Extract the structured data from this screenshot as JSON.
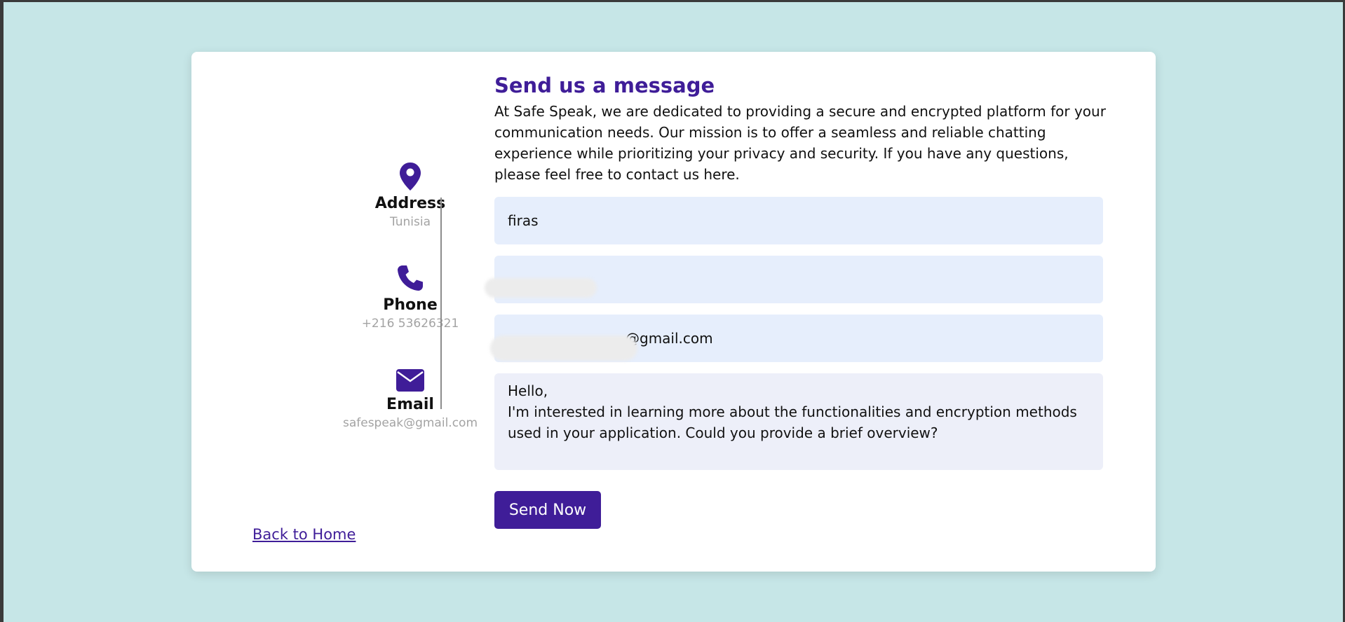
{
  "contact_info": {
    "address": {
      "icon": "map-pin-icon",
      "title": "Address",
      "value": "Tunisia"
    },
    "phone": {
      "icon": "phone-icon",
      "title": "Phone",
      "value": "+216 53626321"
    },
    "email": {
      "icon": "envelope-icon",
      "title": "Email",
      "value": "safespeak@gmail.com"
    }
  },
  "back_link": "Back to Home",
  "form": {
    "title": "Send us a message",
    "description": "At Safe Speak, we are dedicated to providing a secure and encrypted platform for your communication needs. Our mission is to offer a seamless and reliable chatting experience while prioritizing your privacy and security. If you have any questions, please feel free to contact us here.",
    "name_value": "firas",
    "phone_value": "",
    "email_value": "@gmail.com",
    "message_value": "Hello,\nI'm interested in learning more about the functionalities and encryption methods used in your application. Could you provide a brief overview?",
    "submit_label": "Send Now"
  },
  "colors": {
    "accent": "#3f1d98",
    "background": "#c6e6e7",
    "input_bg": "#e6eefc",
    "muted_text": "#a3a3a3"
  }
}
